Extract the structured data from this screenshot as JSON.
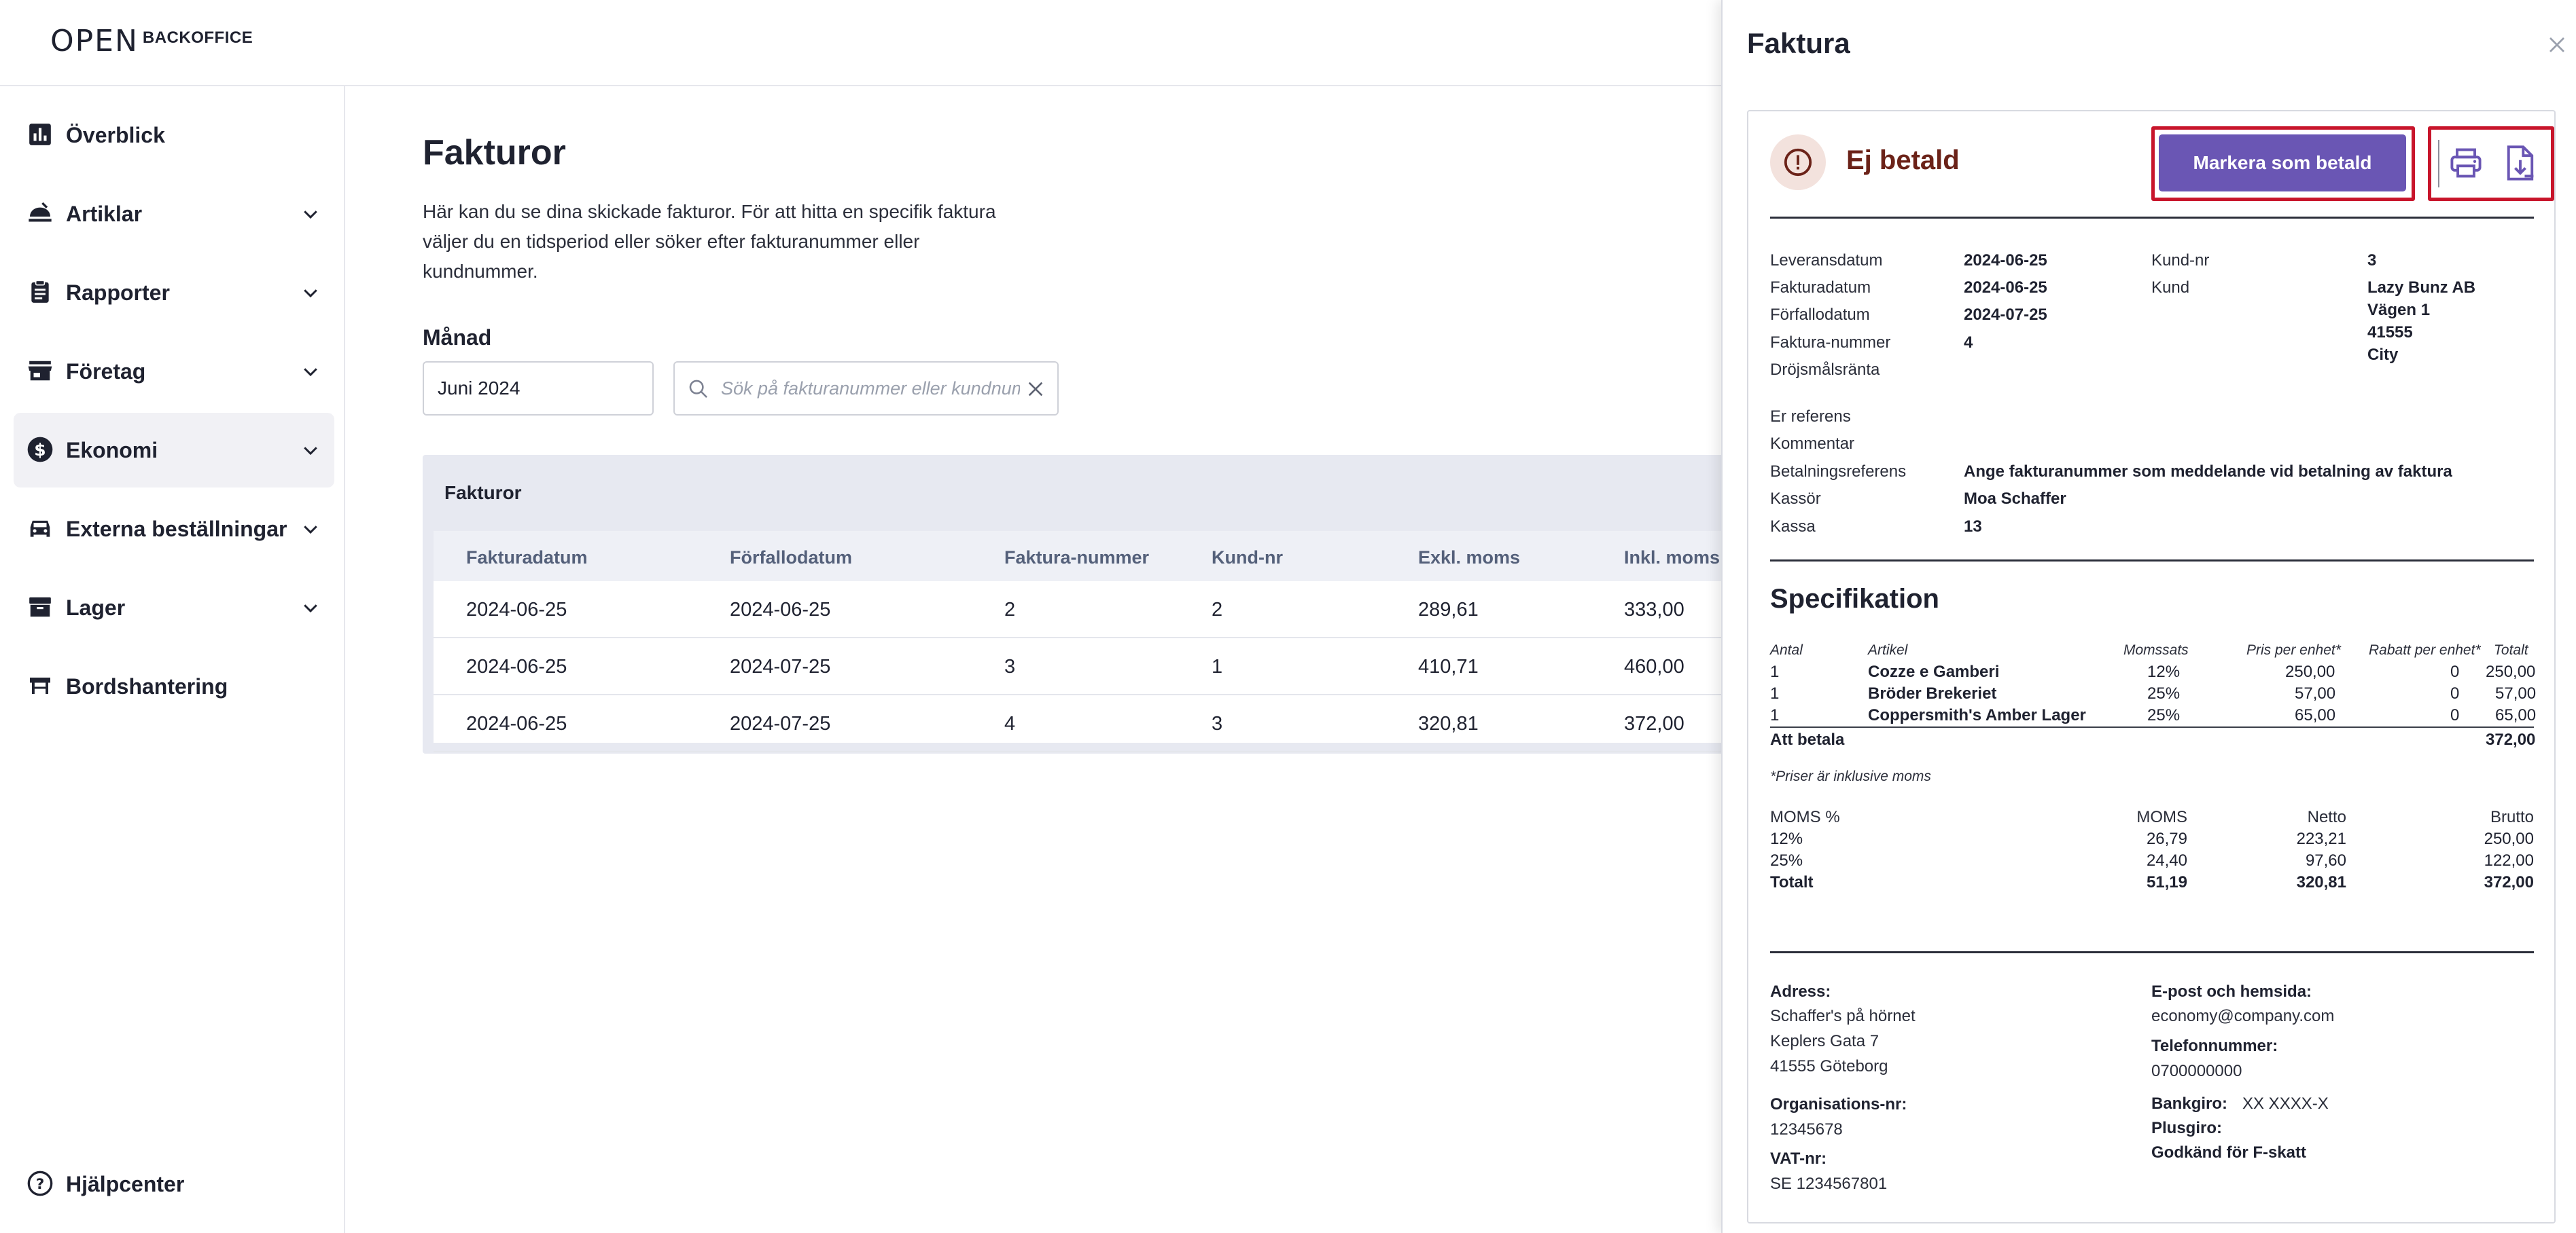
{
  "app": {
    "logo_mark": "OPEN",
    "logo_word": "BACKOFFICE"
  },
  "sidebar": {
    "items": [
      {
        "label": "Överblick",
        "icon": "bar-chart-icon",
        "has_chevron": false
      },
      {
        "label": "Artiklar",
        "icon": "food-icon",
        "has_chevron": true
      },
      {
        "label": "Rapporter",
        "icon": "clipboard-icon",
        "has_chevron": true
      },
      {
        "label": "Företag",
        "icon": "store-icon",
        "has_chevron": true
      },
      {
        "label": "Ekonomi",
        "icon": "dollar-icon",
        "has_chevron": true,
        "active": true
      },
      {
        "label": "Externa beställningar",
        "icon": "car-icon",
        "has_chevron": true
      },
      {
        "label": "Lager",
        "icon": "archive-icon",
        "has_chevron": true
      },
      {
        "label": "Bordshantering",
        "icon": "table-icon",
        "has_chevron": false
      }
    ],
    "help_label": "Hjälpcenter"
  },
  "main": {
    "title": "Fakturor",
    "description": "Här kan du se dina skickade fakturor. För att hitta en specifik faktura väljer du en tidsperiod eller söker efter fakturanummer eller kundnummer.",
    "month_label": "Månad",
    "month_value": "Juni 2024",
    "search_placeholder": "Sök på fakturanummer eller kundnummer",
    "table": {
      "title": "Fakturor",
      "columns": [
        "Fakturadatum",
        "Förfallodatum",
        "Faktura-nummer",
        "Kund-nr",
        "Exkl. moms",
        "Inkl. moms"
      ],
      "rows": [
        [
          "2024-06-25",
          "2024-06-25",
          "2",
          "2",
          "289,61",
          "333,00"
        ],
        [
          "2024-06-25",
          "2024-07-25",
          "3",
          "1",
          "410,71",
          "460,00"
        ],
        [
          "2024-06-25",
          "2024-07-25",
          "4",
          "3",
          "320,81",
          "372,00"
        ]
      ]
    }
  },
  "drawer": {
    "title": "Faktura",
    "status": "Ej betald",
    "mark_paid_label": "Markera som betald",
    "details_left": [
      {
        "label": "Leveransdatum",
        "value": "2024-06-25"
      },
      {
        "label": "Fakturadatum",
        "value": "2024-06-25"
      },
      {
        "label": "Förfallodatum",
        "value": "2024-07-25"
      },
      {
        "label": "Faktura-nummer",
        "value": "4"
      },
      {
        "label": "Dröjsmålsränta",
        "value": ""
      }
    ],
    "details_right": {
      "customer_no_label": "Kund-nr",
      "customer_no": "3",
      "customer_label": "Kund",
      "customer_lines": [
        "Lazy Bunz AB",
        "Vägen 1",
        "41555",
        "City"
      ]
    },
    "details_more": [
      {
        "label": "Er referens",
        "value": ""
      },
      {
        "label": "Kommentar",
        "value": ""
      },
      {
        "label": "Betalningsreferens",
        "value": "Ange fakturanummer som meddelande vid betalning av faktura"
      },
      {
        "label": "Kassör",
        "value": "Moa Schaffer"
      },
      {
        "label": "Kassa",
        "value": "13"
      }
    ],
    "specification": {
      "title": "Specifikation",
      "headers": [
        "Antal",
        "Artikel",
        "Momssats",
        "Pris per enhet*",
        "Rabatt per enhet*",
        "Totalt"
      ],
      "rows": [
        [
          "1",
          "Cozze e Gamberi",
          "12%",
          "250,00",
          "0",
          "250,00"
        ],
        [
          "1",
          "Bröder Brekeriet",
          "25%",
          "57,00",
          "0",
          "57,00"
        ],
        [
          "1",
          "Coppersmith's Amber Lager",
          "25%",
          "65,00",
          "0",
          "65,00"
        ]
      ],
      "total_label": "Att betala",
      "total_value": "372,00",
      "note": "*Priser är inklusive moms"
    },
    "vat": {
      "headers": [
        "MOMS %",
        "MOMS",
        "Netto",
        "Brutto"
      ],
      "rows": [
        [
          "12%",
          "26,79",
          "223,21",
          "250,00"
        ],
        [
          "25%",
          "24,40",
          "97,60",
          "122,00"
        ]
      ],
      "total": [
        "Totalt",
        "51,19",
        "320,81",
        "372,00"
      ]
    },
    "footer": {
      "address_label": "Adress:",
      "address_lines": [
        "Schaffer's på hörnet",
        "Keplers Gata 7",
        "41555 Göteborg"
      ],
      "org_label": "Organisations-nr:",
      "org_value": "12345678",
      "vat_label": "VAT-nr:",
      "vat_value": "SE 1234567801",
      "email_label": "E-post och hemsida:",
      "email_value": "economy@company.com",
      "phone_label": "Telefonnummer:",
      "phone_value": "0700000000",
      "bankgiro_label": "Bankgiro:",
      "bankgiro_value": "XX XXXX-X",
      "plusgiro_label": "Plusgiro:",
      "fskatt_label": "Godkänd för F-skatt"
    }
  },
  "colors": {
    "accent": "#6a56b4",
    "status_text": "#6b2218",
    "highlight_frame": "#c8152b",
    "table_header_bg": "#e7e9f1"
  }
}
